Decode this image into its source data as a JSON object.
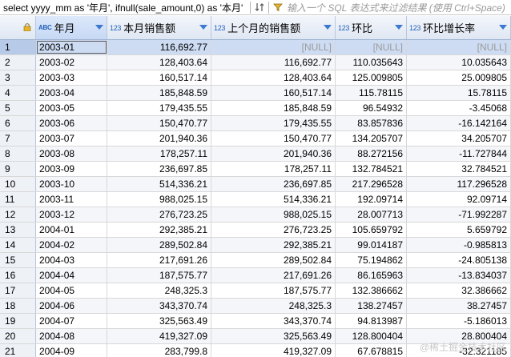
{
  "filter_bar": {
    "query_text": "select yyyy_mm as '年月', ifnull(sale_amount,0) as '本月'",
    "placeholder": "输入一个 SQL 表达式来过滤结果 (使用 Ctrl+Space)"
  },
  "columns": [
    {
      "type": "ABC",
      "label": "年月"
    },
    {
      "type": "123",
      "label": "本月销售额"
    },
    {
      "type": "123",
      "label": "上个月的销售额"
    },
    {
      "type": "123",
      "label": "环比"
    },
    {
      "type": "123",
      "label": "环比增长率"
    }
  ],
  "rows": [
    {
      "n": "1",
      "ym": "2003-01",
      "cur": "116,692.77",
      "prev": "[NULL]",
      "mom": "[NULL]",
      "rate": "[NULL]"
    },
    {
      "n": "2",
      "ym": "2003-02",
      "cur": "128,403.64",
      "prev": "116,692.77",
      "mom": "110.035643",
      "rate": "10.035643"
    },
    {
      "n": "3",
      "ym": "2003-03",
      "cur": "160,517.14",
      "prev": "128,403.64",
      "mom": "125.009805",
      "rate": "25.009805"
    },
    {
      "n": "4",
      "ym": "2003-04",
      "cur": "185,848.59",
      "prev": "160,517.14",
      "mom": "115.78115",
      "rate": "15.78115"
    },
    {
      "n": "5",
      "ym": "2003-05",
      "cur": "179,435.55",
      "prev": "185,848.59",
      "mom": "96.54932",
      "rate": "-3.45068"
    },
    {
      "n": "6",
      "ym": "2003-06",
      "cur": "150,470.77",
      "prev": "179,435.55",
      "mom": "83.857836",
      "rate": "-16.142164"
    },
    {
      "n": "7",
      "ym": "2003-07",
      "cur": "201,940.36",
      "prev": "150,470.77",
      "mom": "134.205707",
      "rate": "34.205707"
    },
    {
      "n": "8",
      "ym": "2003-08",
      "cur": "178,257.11",
      "prev": "201,940.36",
      "mom": "88.272156",
      "rate": "-11.727844"
    },
    {
      "n": "9",
      "ym": "2003-09",
      "cur": "236,697.85",
      "prev": "178,257.11",
      "mom": "132.784521",
      "rate": "32.784521"
    },
    {
      "n": "10",
      "ym": "2003-10",
      "cur": "514,336.21",
      "prev": "236,697.85",
      "mom": "217.296528",
      "rate": "117.296528"
    },
    {
      "n": "11",
      "ym": "2003-11",
      "cur": "988,025.15",
      "prev": "514,336.21",
      "mom": "192.09714",
      "rate": "92.09714"
    },
    {
      "n": "12",
      "ym": "2003-12",
      "cur": "276,723.25",
      "prev": "988,025.15",
      "mom": "28.007713",
      "rate": "-71.992287"
    },
    {
      "n": "13",
      "ym": "2004-01",
      "cur": "292,385.21",
      "prev": "276,723.25",
      "mom": "105.659792",
      "rate": "5.659792"
    },
    {
      "n": "14",
      "ym": "2004-02",
      "cur": "289,502.84",
      "prev": "292,385.21",
      "mom": "99.014187",
      "rate": "-0.985813"
    },
    {
      "n": "15",
      "ym": "2004-03",
      "cur": "217,691.26",
      "prev": "289,502.84",
      "mom": "75.194862",
      "rate": "-24.805138"
    },
    {
      "n": "16",
      "ym": "2004-04",
      "cur": "187,575.77",
      "prev": "217,691.26",
      "mom": "86.165963",
      "rate": "-13.834037"
    },
    {
      "n": "17",
      "ym": "2004-05",
      "cur": "248,325.3",
      "prev": "187,575.77",
      "mom": "132.386662",
      "rate": "32.386662"
    },
    {
      "n": "18",
      "ym": "2004-06",
      "cur": "343,370.74",
      "prev": "248,325.3",
      "mom": "138.27457",
      "rate": "38.27457"
    },
    {
      "n": "19",
      "ym": "2004-07",
      "cur": "325,563.49",
      "prev": "343,370.74",
      "mom": "94.813987",
      "rate": "-5.186013"
    },
    {
      "n": "20",
      "ym": "2004-08",
      "cur": "419,327.09",
      "prev": "325,563.49",
      "mom": "128.800404",
      "rate": "28.800404"
    },
    {
      "n": "21",
      "ym": "2004-09",
      "cur": "283,799.8",
      "prev": "419,327.09",
      "mom": "67.678815",
      "rate": "-32.321185"
    }
  ],
  "watermark": "@稀土掘金技术社区",
  "colors": {
    "header_bg": "#e9eef6",
    "selected_row": "#cddcf3",
    "type_icon": "#1f5fb8"
  }
}
